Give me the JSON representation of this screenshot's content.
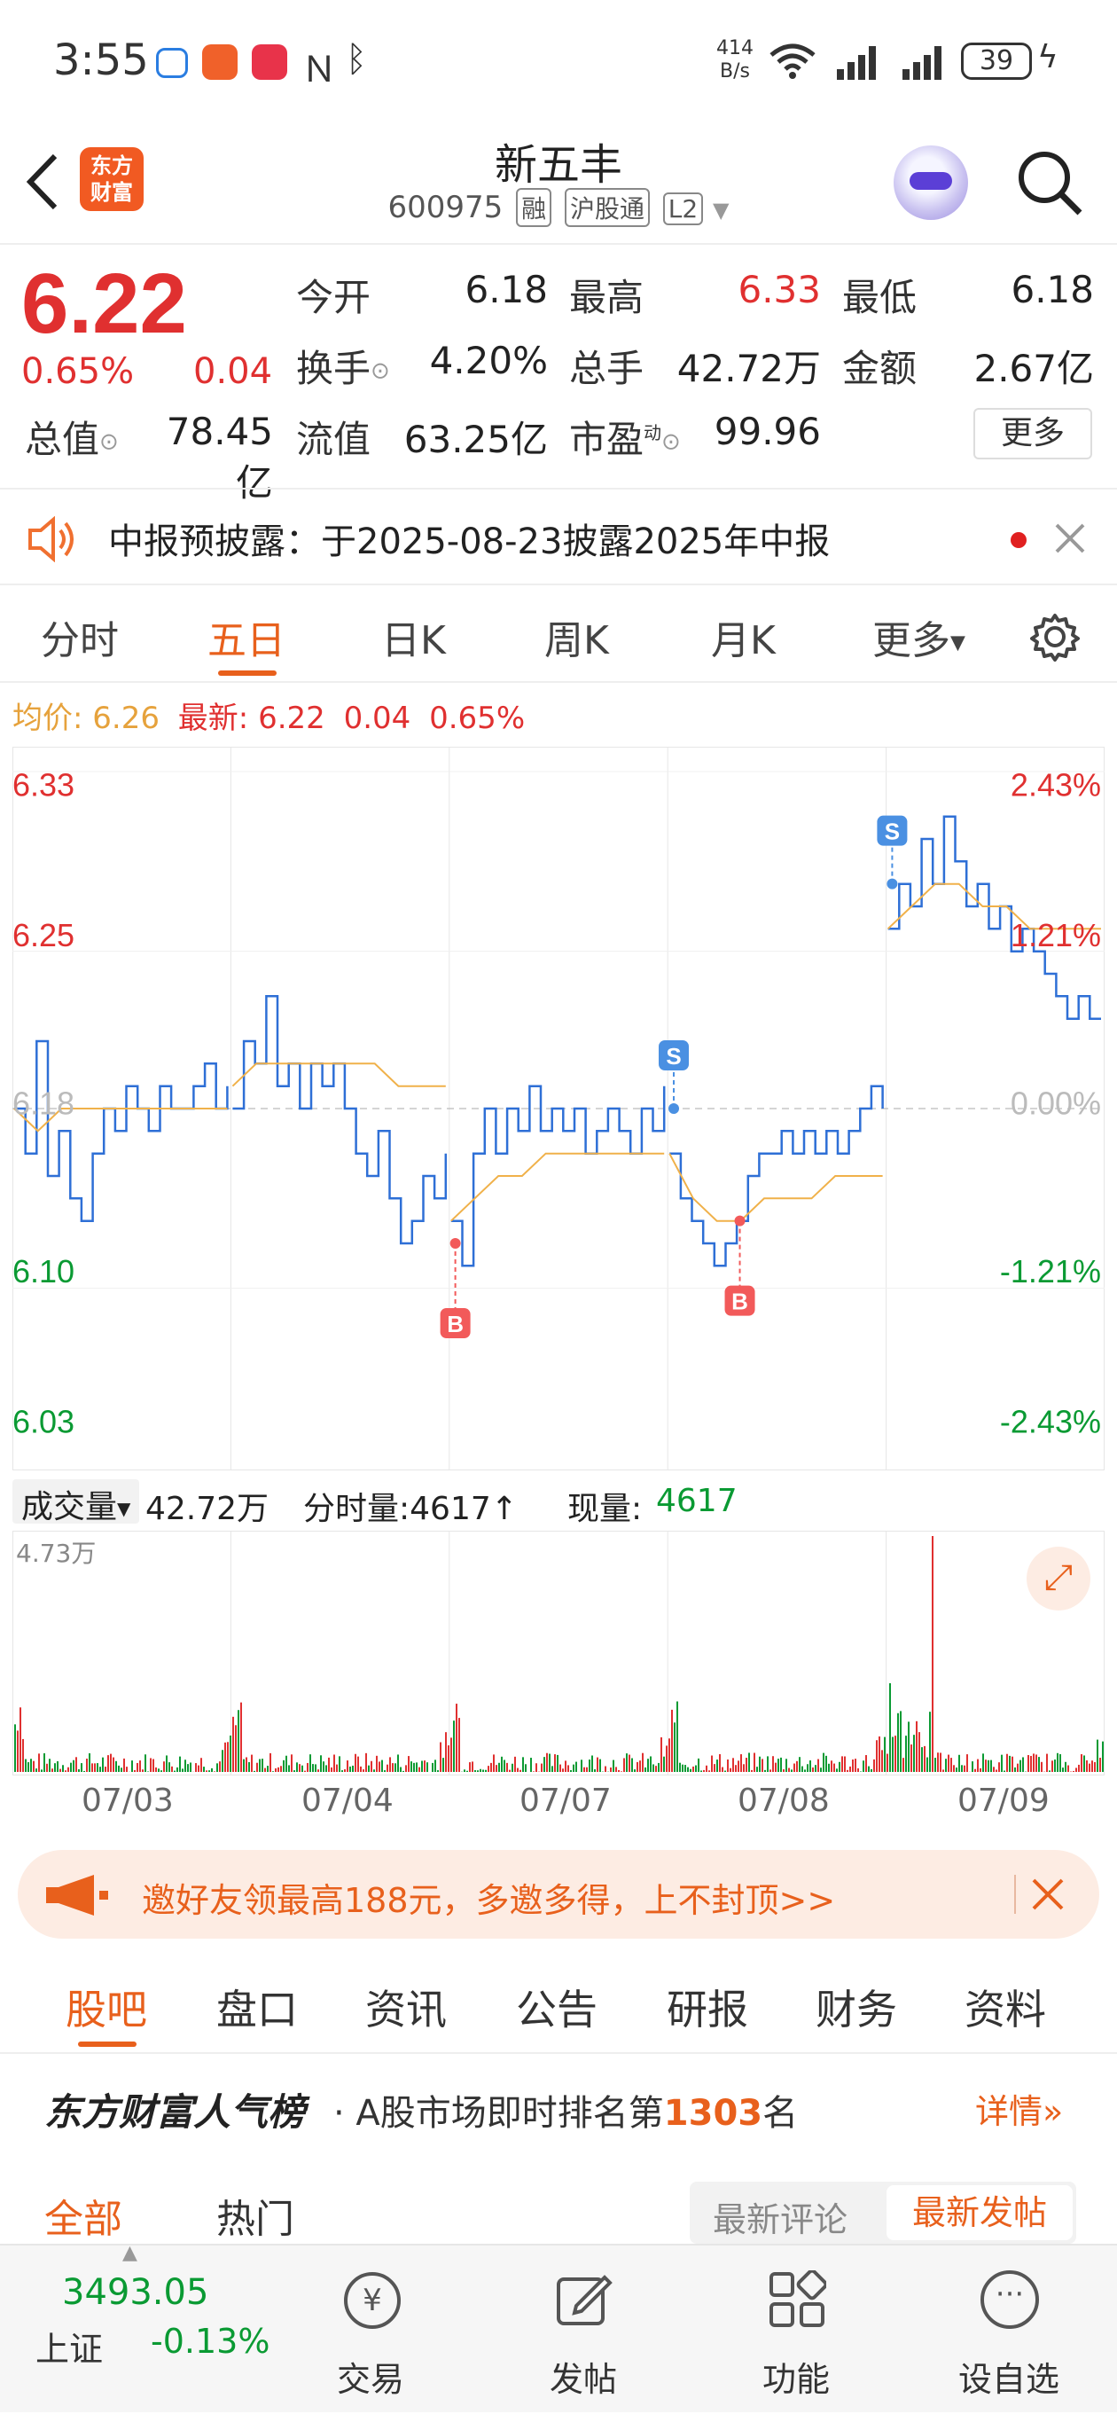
{
  "status_bar": {
    "time": "3:55",
    "net_speed_top": "414",
    "net_speed_bottom": "B/s",
    "battery": "39"
  },
  "header": {
    "back_icon": "chevron-left-icon",
    "logo_line1": "东方",
    "logo_line2": "财富",
    "title": "新五丰",
    "code": "600975",
    "tags": [
      "融",
      "沪股通",
      "L2"
    ],
    "search_icon": "search-icon"
  },
  "quote": {
    "price": "6.22",
    "change_pct": "0.65%",
    "change_amt": "0.04",
    "row1": [
      {
        "label": "今开",
        "value": "6.18",
        "color": "#222"
      },
      {
        "label": "最高",
        "value": "6.33",
        "color": "#e03030"
      },
      {
        "label": "最低",
        "value": "6.18",
        "color": "#222"
      }
    ],
    "row2": [
      {
        "label": "换手",
        "value": "4.20%",
        "color": "#222"
      },
      {
        "label": "总手",
        "value": "42.72万",
        "color": "#222"
      },
      {
        "label": "金额",
        "value": "2.67亿",
        "color": "#222"
      }
    ],
    "row3": [
      {
        "label": "总值",
        "value": "78.45亿",
        "color": "#222"
      },
      {
        "label": "流值",
        "value": "63.25亿",
        "color": "#222"
      },
      {
        "label": "市盈",
        "label_sup": "动",
        "value": "99.96",
        "color": "#222"
      }
    ],
    "more_button": "更多"
  },
  "notice": {
    "text": "中报预披露：于2025-08-23披露2025年中报"
  },
  "chart_tabs": {
    "items": [
      "分时",
      "五日",
      "日K",
      "周K",
      "月K",
      "更多"
    ],
    "active": 1
  },
  "legend": {
    "avg_label": "均价:",
    "avg_value": "6.26",
    "latest_label": "最新:",
    "latest_value": "6.22",
    "latest_change": "0.04",
    "latest_pct": "0.65%"
  },
  "chart_data": {
    "type": "line",
    "y_ticks_left": [
      "6.33",
      "6.25",
      "6.18",
      "6.10",
      "6.03"
    ],
    "y_ticks_right": [
      "2.43%",
      "1.21%",
      "0.00%",
      "-1.21%",
      "-2.43%"
    ],
    "ylim": [
      6.03,
      6.33
    ],
    "prev_close": 6.18,
    "days": [
      "07/03",
      "07/04",
      "07/07",
      "07/08",
      "07/09"
    ],
    "series": [
      {
        "name": "",
        "color": "#2e6fd6",
        "values": [
          [
            6.18,
            6.16,
            6.21,
            6.15,
            6.17,
            6.14,
            6.13,
            6.16,
            6.18,
            6.17,
            6.19,
            6.18,
            6.17,
            6.19,
            6.18,
            6.18,
            6.19,
            6.2,
            6.18,
            6.19
          ],
          [
            6.18,
            6.21,
            6.2,
            6.23,
            6.19,
            6.2,
            6.18,
            6.2,
            6.19,
            6.2,
            6.18,
            6.16,
            6.15,
            6.17,
            6.14,
            6.12,
            6.13,
            6.15,
            6.14,
            6.16
          ],
          [
            6.13,
            6.11,
            6.16,
            6.18,
            6.16,
            6.18,
            6.17,
            6.19,
            6.17,
            6.18,
            6.17,
            6.18,
            6.16,
            6.17,
            6.18,
            6.17,
            6.16,
            6.18,
            6.17,
            6.19
          ],
          [
            6.16,
            6.14,
            6.13,
            6.12,
            6.11,
            6.12,
            6.13,
            6.15,
            6.16,
            6.16,
            6.17,
            6.16,
            6.17,
            6.16,
            6.17,
            6.16,
            6.17,
            6.18,
            6.19,
            6.18
          ],
          [
            6.26,
            6.28,
            6.27,
            6.3,
            6.28,
            6.31,
            6.29,
            6.27,
            6.28,
            6.26,
            6.27,
            6.25,
            6.26,
            6.25,
            6.24,
            6.23,
            6.22,
            6.23,
            6.22,
            6.22
          ]
        ]
      },
      {
        "name": "",
        "color": "#f0b14a",
        "values": [
          [
            6.18,
            6.17,
            6.18,
            6.18,
            6.18,
            6.18,
            6.18,
            6.18,
            6.18,
            6.18
          ],
          [
            6.19,
            6.2,
            6.2,
            6.2,
            6.2,
            6.2,
            6.2,
            6.19,
            6.19,
            6.19
          ],
          [
            6.13,
            6.14,
            6.15,
            6.15,
            6.16,
            6.16,
            6.16,
            6.16,
            6.16,
            6.16
          ],
          [
            6.16,
            6.14,
            6.13,
            6.13,
            6.14,
            6.14,
            6.14,
            6.15,
            6.15,
            6.15
          ],
          [
            6.26,
            6.27,
            6.28,
            6.28,
            6.27,
            6.27,
            6.26,
            6.26,
            6.26,
            6.26
          ]
        ]
      }
    ],
    "signals": [
      {
        "label": "S",
        "day": 3,
        "pos": 0.02,
        "value": 6.18
      },
      {
        "label": "S",
        "day": 4,
        "pos": 0.02,
        "value": 6.28
      },
      {
        "label": "B",
        "day": 2,
        "pos": 0.02,
        "value": 6.12
      },
      {
        "label": "B",
        "day": 3,
        "pos": 0.33,
        "value": 6.13
      }
    ]
  },
  "volume": {
    "label": "成交量",
    "total": "42.72万",
    "tick_label": "分时量:4617",
    "now_label": "现量:",
    "now_value": "4617",
    "max_label": "4.73万"
  },
  "promo": {
    "text": "邀好友领最高188元，多邀多得，上不封顶>>"
  },
  "sub_tabs": {
    "items": [
      "股吧",
      "盘口",
      "资讯",
      "公告",
      "研报",
      "财务",
      "资料"
    ],
    "active": 0
  },
  "rank": {
    "brand": "东方财富人气榜",
    "text_prefix": "· A股市场即时排名第",
    "rank_number": "1303",
    "text_suffix": "名",
    "detail": "详情"
  },
  "filter": {
    "all": "全部",
    "hot": "热门",
    "latest_comment": "最新评论",
    "latest_post": "最新发帖"
  },
  "bottom_bar": {
    "index_value": "3493.05",
    "index_name": "上证",
    "index_change": "-0.13%",
    "items": [
      {
        "label": "交易",
        "icon": "trade-icon"
      },
      {
        "label": "发帖",
        "icon": "edit-icon"
      },
      {
        "label": "功能",
        "icon": "grid-icon"
      },
      {
        "label": "设自选",
        "icon": "more-icon"
      }
    ]
  }
}
